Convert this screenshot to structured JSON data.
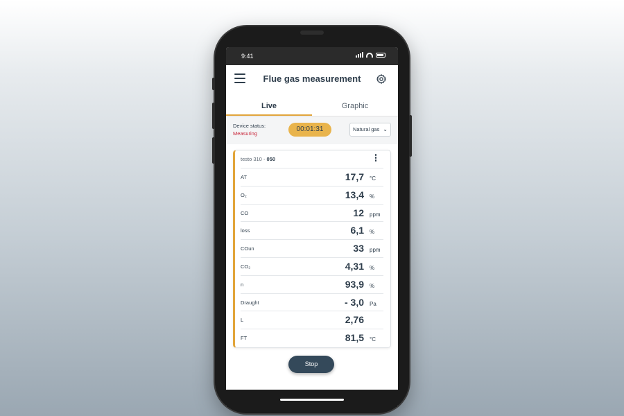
{
  "statusbar": {
    "time": "9:41",
    "icons": [
      "signal-icon",
      "wifi-icon",
      "battery-icon"
    ]
  },
  "appbar": {
    "title": "Flue gas measurement",
    "menu_icon": "hamburger-menu-icon",
    "settings_icon": "gear-icon"
  },
  "tabs": [
    {
      "label": "Live",
      "active": true
    },
    {
      "label": "Graphic",
      "active": false
    }
  ],
  "device": {
    "status_label": "Device status:",
    "status_value": "Measuring",
    "timer": "00:01:31",
    "fuel_select": "Natural gas"
  },
  "card": {
    "device_name": "testo 310",
    "separator": " - ",
    "device_id": "050",
    "rows": [
      {
        "label": "AT",
        "value": "17,7",
        "unit": "°C"
      },
      {
        "label": "O₂",
        "value": "13,4",
        "unit": "%"
      },
      {
        "label": "CO",
        "value": "12",
        "unit": "ppm"
      },
      {
        "label": "loss",
        "value": "6,1",
        "unit": "%"
      },
      {
        "label": "COun",
        "value": "33",
        "unit": "ppm"
      },
      {
        "label": "CO₂",
        "value": "4,31",
        "unit": "%"
      },
      {
        "label": "n",
        "value": "93,9",
        "unit": "%"
      },
      {
        "label": "Draught",
        "value": "- 3,0",
        "unit": "Pa"
      },
      {
        "label": "L",
        "value": "2,76",
        "unit": ""
      },
      {
        "label": "FT",
        "value": "81,5",
        "unit": "°C"
      }
    ]
  },
  "actions": {
    "stop_label": "Stop"
  },
  "colors": {
    "accent": "#e2a53a",
    "timer_bg": "#e9b44c",
    "status_red": "#c8283c",
    "button_dark": "#34495a",
    "text_dark": "#2f3e4c"
  }
}
